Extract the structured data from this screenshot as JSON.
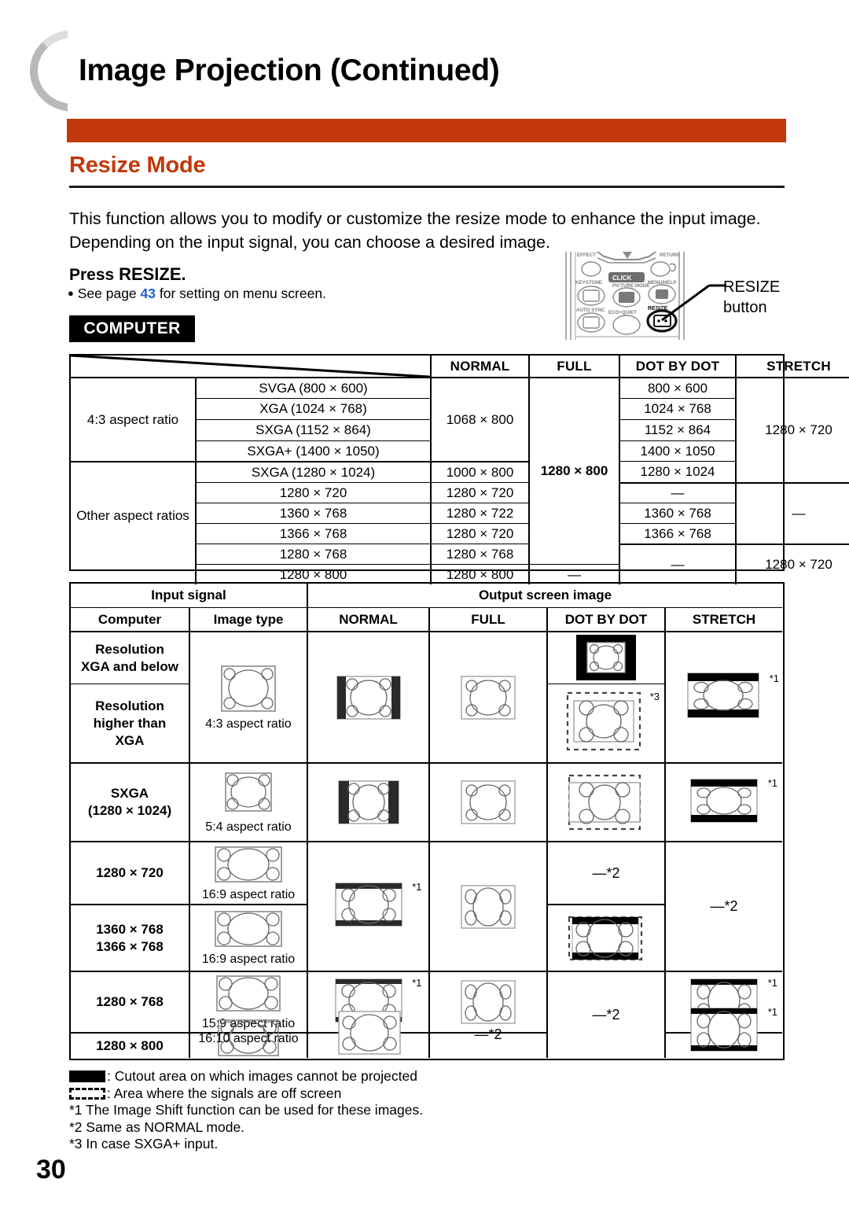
{
  "page": {
    "title": "Image Projection (Continued)",
    "number": "30",
    "accent_color": "#c2380c",
    "link_color": "#1c5fd0"
  },
  "section": {
    "heading": "Resize Mode",
    "intro": "This function allows you to modify or customize the resize mode to enhance the input image. Depending on the input signal, you can choose a desired image.",
    "press_label": "Press ",
    "press_keyword": "RESIZE.",
    "see_page_before": "See page ",
    "see_page_number": "43",
    "see_page_after": " for setting on menu screen.",
    "computer_tag": "COMPUTER"
  },
  "remote": {
    "callout_line1": "RESIZE",
    "callout_line2": "button",
    "button_labels": {
      "effect": "EFFECT",
      "return": "RETURN",
      "keystone": "KEYSTONE",
      "click": "CLICK",
      "menu_help": "MENU/HELP",
      "picture_mode": "PICTURE MODE",
      "auto_sync": "AUTO SYNC",
      "eco_quiet": "ECO+QUIET",
      "resize": "RESIZE"
    }
  },
  "table1": {
    "headers": [
      "NORMAL",
      "FULL",
      "DOT BY DOT",
      "STRETCH"
    ],
    "groups": [
      {
        "label": "4:3 aspect ratio",
        "rows": [
          {
            "signal": "SVGA (800 × 600)",
            "dot": "800 × 600"
          },
          {
            "signal": "XGA (1024 × 768)",
            "dot": "1024 × 768"
          },
          {
            "signal": "SXGA (1152 × 864)",
            "dot": "1152 × 864"
          },
          {
            "signal": "SXGA+ (1400 × 1050)",
            "dot": "1400 × 1050"
          }
        ],
        "normal": "1068 × 800"
      },
      {
        "label": "Other aspect ratios",
        "rows": [
          {
            "signal": "SXGA (1280 × 1024)",
            "normal": "1000 × 800",
            "dot": "1280 × 1024"
          },
          {
            "signal": "1280 × 720",
            "normal": "1280 × 720",
            "dot": "—"
          },
          {
            "signal": "1360 × 768",
            "normal": "1280 × 722",
            "dot": "1360 × 768"
          },
          {
            "signal": "1366 × 768",
            "normal": "1280 × 720",
            "dot": "1366 × 768"
          },
          {
            "signal": "1280 × 768",
            "normal": "1280 × 768",
            "dot": "—"
          },
          {
            "signal": "1280 × 800",
            "normal": "1280 × 800",
            "dot": "—"
          }
        ]
      }
    ],
    "full_main": "1280 × 800",
    "full_last": "—",
    "stretch_top": "1280 × 720",
    "stretch_mid": "—",
    "stretch_bottom": "1280 × 720"
  },
  "table2": {
    "header_input": "Input signal",
    "header_output": "Output screen image",
    "sub_computer": "Computer",
    "sub_image_type": "Image type",
    "modes": [
      "NORMAL",
      "FULL",
      "DOT BY DOT",
      "STRETCH"
    ],
    "rows": [
      {
        "computer": "Resolution\nXGA and below",
        "image_caption": "4:3 aspect ratio",
        "image_ratio": "4:3"
      },
      {
        "computer": "Resolution\nhigher than\nXGA",
        "image_caption": "",
        "image_ratio": "4:3"
      },
      {
        "computer": "SXGA\n(1280 × 1024)",
        "image_caption": "5:4 aspect ratio",
        "image_ratio": "5:4"
      },
      {
        "computer": "1280 × 720",
        "image_caption": "16:9 aspect ratio",
        "image_ratio": "16:9"
      },
      {
        "computer": "1360 × 768\n1366 × 768",
        "image_caption": "16:9 aspect ratio",
        "image_ratio": "16:9"
      },
      {
        "computer": "1280 × 768",
        "image_caption": "15:9 aspect ratio",
        "image_ratio": "15:9"
      },
      {
        "computer": "1280 × 800",
        "image_caption": "16:10 aspect ratio",
        "image_ratio": "16:10"
      }
    ],
    "notes": {
      "star1": "*1",
      "star2": "*2",
      "star3": "*3",
      "dash_star2": "—*2"
    }
  },
  "footnotes": {
    "legend_solid": ": Cutout area on which images cannot be projected",
    "legend_dashed": ": Area where the signals are off screen",
    "note1": "*1 The Image Shift function can be used for these images.",
    "note2": "*2 Same as NORMAL mode.",
    "note3": "*3 In case SXGA+ input."
  }
}
